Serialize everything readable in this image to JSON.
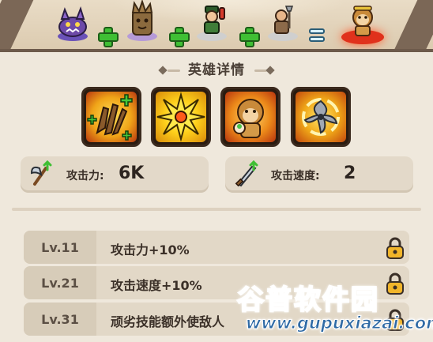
{
  "recipe": {
    "ingredients": [
      {
        "name": "purple-beast-hero",
        "pad_color": "#6a52b8"
      },
      {
        "name": "tree-stump-hero",
        "pad_color": "#b59ad8"
      },
      {
        "name": "soldier-hero",
        "pad_color": "#cfcfcf"
      },
      {
        "name": "warrior-hero",
        "pad_color": "#cfcfcf"
      }
    ],
    "result": {
      "name": "monkey-king-hero",
      "pad_color": "#e0311c"
    }
  },
  "details": {
    "title": "英雄详情",
    "skills": [
      {
        "icon": "claw-skill-icon"
      },
      {
        "icon": "burst-skill-icon"
      },
      {
        "icon": "monkey-skill-icon"
      },
      {
        "icon": "shuriken-skill-icon"
      }
    ]
  },
  "stats": {
    "attack": {
      "label": "攻击力:",
      "value": "6K"
    },
    "speed": {
      "label": "攻击速度:",
      "value": "2"
    }
  },
  "upgrades": [
    {
      "level": "Lv.11",
      "text": "攻击力+10%",
      "locked": true
    },
    {
      "level": "Lv.21",
      "text": "攻击速度+10%",
      "locked": true
    },
    {
      "level": "Lv.31",
      "text": "顽劣技能额外使敌人",
      "locked": true
    }
  ],
  "watermark": {
    "main": "谷普软件园",
    "url": "www.gupuxiazai.com"
  },
  "colors": {
    "accent_green": "#3fbf34",
    "background": "#efe8dc",
    "row_bg": "#e2d8c7",
    "result_glow": "#e0311c"
  }
}
